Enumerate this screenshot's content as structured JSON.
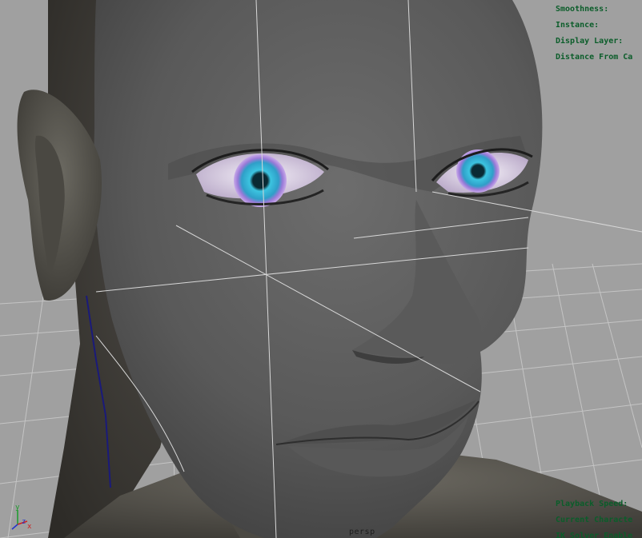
{
  "viewport": {
    "camera_name": "persp",
    "background_color": "#a0a0a0",
    "grid_color": "#c4c4c4",
    "hud_color": "#0b5d2a"
  },
  "hud_top": [
    {
      "label": "Smoothness:"
    },
    {
      "label": "Instance:"
    },
    {
      "label": "Display Layer:"
    },
    {
      "label": "Distance From Ca"
    }
  ],
  "hud_bottom": [
    {
      "label": "Playback Speed:"
    },
    {
      "label": "Current Characte"
    },
    {
      "label": "IK Solver Enable"
    }
  ],
  "axis_gizmo": {
    "y_label": "y",
    "z_label": "z",
    "x_label": "x",
    "y_color": "#1a9c2a",
    "z_color": "#2233cc",
    "x_color": "#cc2222"
  },
  "model": {
    "iris_color": "#2f9fc8",
    "iris_ring_color": "#9a7ad8",
    "skin_color": "#5c5c5c"
  }
}
